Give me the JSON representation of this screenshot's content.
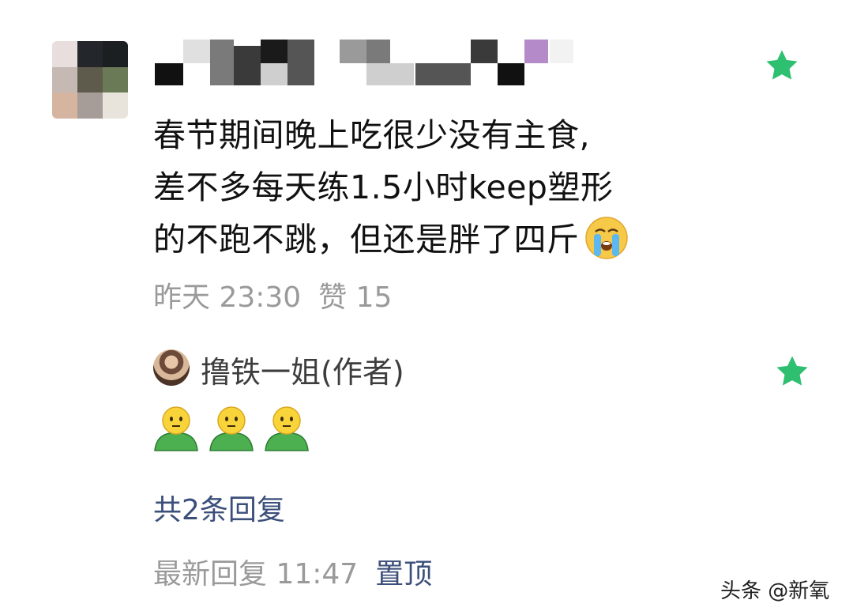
{
  "comment": {
    "avatar_colors": [
      "#e9dede",
      "#23262b",
      "#1c1f22",
      "#c6b8b3",
      "#5e5b4c",
      "#6a7a56",
      "#d6b5a0",
      "#a69c98",
      "#e8e4dc"
    ],
    "username_mosaic_colors": [
      "#111111",
      "#e0e0e0",
      "#7a7a7a",
      "#3a3a3a",
      "#1a1a1a",
      "#cfcfcf",
      "#555555",
      "#9a9a9a",
      "#b58ac9",
      "#f2f2f2"
    ],
    "text_lines": [
      "春节期间晚上吃很少没有主食,",
      "差不多每天练1.5小时keep塑形",
      "的不跑不跳，但还是胖了四斤"
    ],
    "time": "昨天 23:30",
    "likes": "赞 15"
  },
  "reply": {
    "author": "撸铁一姐(作者)",
    "count_label": "共2条回复"
  },
  "footer": {
    "latest_reply": "最新回复 11:47",
    "pin_label": "置顶"
  },
  "watermark": "头条 @新氧",
  "icons": {
    "star_color": "#2fbf71",
    "cry_emoji": "loudly-crying-face",
    "reply_emoji": "green-shirt-person"
  }
}
